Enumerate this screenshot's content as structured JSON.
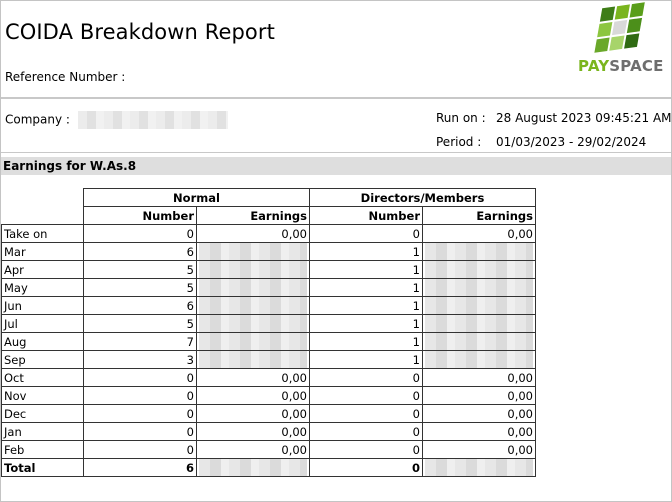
{
  "report": {
    "title": "COIDA Breakdown Report",
    "reference_label": "Reference Number :",
    "company_label": "Company :",
    "run_on_label": "Run on :",
    "run_on_value": "28 August 2023 09:45:21 AM",
    "period_label": "Period :",
    "period_value": "01/03/2023 - 29/02/2024"
  },
  "logo": {
    "pay": "PAY",
    "space": "SPACE",
    "accent_color": "#7ab51d"
  },
  "section": {
    "title": "Earnings for W.As.8"
  },
  "table": {
    "group_normal": "Normal",
    "group_directors": "Directors/Members",
    "col_number": "Number",
    "col_earnings": "Earnings",
    "rows": [
      {
        "month": "Take on",
        "n_num": "0",
        "n_earn": "0,00",
        "d_num": "0",
        "d_earn": "0,00"
      },
      {
        "month": "Mar",
        "n_num": "6",
        "n_earn": "",
        "d_num": "1",
        "d_earn": ""
      },
      {
        "month": "Apr",
        "n_num": "5",
        "n_earn": "",
        "d_num": "1",
        "d_earn": ""
      },
      {
        "month": "May",
        "n_num": "5",
        "n_earn": "",
        "d_num": "1",
        "d_earn": ""
      },
      {
        "month": "Jun",
        "n_num": "6",
        "n_earn": "",
        "d_num": "1",
        "d_earn": ""
      },
      {
        "month": "Jul",
        "n_num": "5",
        "n_earn": "",
        "d_num": "1",
        "d_earn": ""
      },
      {
        "month": "Aug",
        "n_num": "7",
        "n_earn": "",
        "d_num": "1",
        "d_earn": ""
      },
      {
        "month": "Sep",
        "n_num": "3",
        "n_earn": "",
        "d_num": "1",
        "d_earn": ""
      },
      {
        "month": "Oct",
        "n_num": "0",
        "n_earn": "0,00",
        "d_num": "0",
        "d_earn": "0,00"
      },
      {
        "month": "Nov",
        "n_num": "0",
        "n_earn": "0,00",
        "d_num": "0",
        "d_earn": "0,00"
      },
      {
        "month": "Dec",
        "n_num": "0",
        "n_earn": "0,00",
        "d_num": "0",
        "d_earn": "0,00"
      },
      {
        "month": "Jan",
        "n_num": "0",
        "n_earn": "0,00",
        "d_num": "0",
        "d_earn": "0,00"
      },
      {
        "month": "Feb",
        "n_num": "0",
        "n_earn": "0,00",
        "d_num": "0",
        "d_earn": "0,00"
      }
    ],
    "total": {
      "label": "Total",
      "n_num": "6",
      "d_num": "0"
    }
  }
}
